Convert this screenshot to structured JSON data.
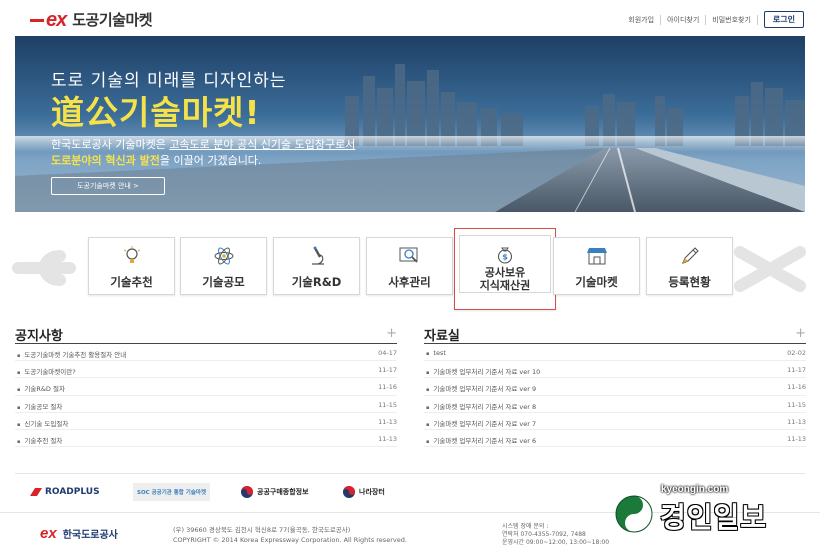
{
  "header": {
    "logo_mark": "ex",
    "logo_text": "도공기술마켓",
    "links": [
      "회원가입",
      "아이디찾기",
      "비밀번호찾기"
    ],
    "login_label": "로그인"
  },
  "banner": {
    "subtitle": "도로 기술의 미래를 디자인하는",
    "title": "道公기술마켓!",
    "desc1_prefix": "한국도로공사 기술마켓은 ",
    "desc1_underlined": "고속도로 분야 공식 신기술 도입창구로서",
    "desc2_highlight": "도로분야의 혁신과 발전",
    "desc2_suffix": "을 이끌어 가겠습니다.",
    "button_label": "도공기술마켓 안내 >"
  },
  "menu": {
    "items": [
      {
        "label": "기술추천",
        "icon": "lightbulb-icon"
      },
      {
        "label": "기술공모",
        "icon": "atom-icon"
      },
      {
        "label": "기술R&D",
        "icon": "microscope-icon"
      },
      {
        "label": "사후관리",
        "icon": "magnifier-icon"
      },
      {
        "label_line1": "공사보유",
        "label_line2": "지식재산권",
        "icon": "money-bag-icon"
      },
      {
        "label": "기술마켓",
        "icon": "shop-icon"
      },
      {
        "label": "등록현황",
        "icon": "pencil-icon"
      }
    ],
    "highlight_color": "#d84b4b"
  },
  "notice": {
    "title": "공지사항",
    "plus": "+",
    "rows": [
      {
        "title": "도공기술마켓 기술추천 활용절차 안내",
        "date": "04-17"
      },
      {
        "title": "도공기술마켓이란?",
        "date": "11-17"
      },
      {
        "title": "기술R&D 절차",
        "date": "11-16"
      },
      {
        "title": "기술공모 절차",
        "date": "11-15"
      },
      {
        "title": "신기술 도입절차",
        "date": "11-13"
      },
      {
        "title": "기술추천 절차",
        "date": "11-13"
      }
    ]
  },
  "archive": {
    "title": "자료실",
    "plus": "+",
    "rows": [
      {
        "title": "test",
        "date": "02-02"
      },
      {
        "title": "기술마켓 업무처리 기준서 자료 ver 10",
        "date": "11-17"
      },
      {
        "title": "기술마켓 업무처리 기준서 자료 ver 9",
        "date": "11-16"
      },
      {
        "title": "기술마켓 업무처리 기준서 자료 ver 8",
        "date": "11-15"
      },
      {
        "title": "기술마켓 업무처리 기준서 자료 ver 7",
        "date": "11-13"
      },
      {
        "title": "기술마켓 업무처리 기준서 자료 ver 6",
        "date": "11-13"
      }
    ]
  },
  "partners": [
    {
      "name": "ROADPLUS"
    },
    {
      "name": "SOC 공공기관 통합 기술마켓"
    },
    {
      "name": "공공구매종합정보"
    },
    {
      "name": "나라장터"
    }
  ],
  "footer": {
    "logo_mark": "ex",
    "logo_name": "한국도로공사",
    "address": "(우) 39660 경상북도 김천시 혁신8로 77(율곡동, 한국도로공사)",
    "copyright": "COPYRIGHT © 2014 Korea Expressway Corporation. All Rights reserved.",
    "contact1": "시스템 장애 문의 :",
    "contact2": "연락처 070-4355-7092, 7488",
    "contact3": "운영시간 09:00~12:00, 13:00~18:00"
  },
  "watermark": {
    "url": "kyeongin.com",
    "name": "경인일보"
  }
}
